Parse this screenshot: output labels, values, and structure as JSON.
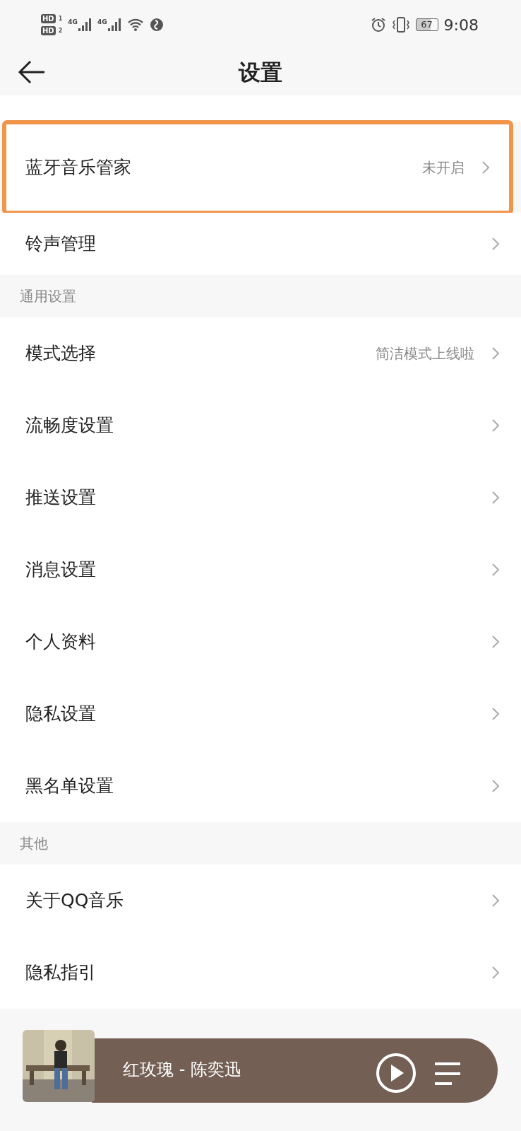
{
  "status_bar": {
    "hd_badges": [
      {
        "label": "HD",
        "slot": "1"
      },
      {
        "label": "HD",
        "slot": "2"
      }
    ],
    "networks": [
      "4G",
      "4G"
    ],
    "battery": "67",
    "time": "9:08"
  },
  "header": {
    "title": "设置"
  },
  "sections": [
    {
      "items": [
        {
          "label": "蓝牙音乐管家",
          "value": "未开启",
          "highlighted": true
        },
        {
          "label": "铃声管理",
          "highlighted": false
        }
      ]
    },
    {
      "title": "通用设置",
      "items": [
        {
          "label": "模式选择",
          "value": "简洁模式上线啦",
          "highlighted": false
        },
        {
          "label": "流畅度设置",
          "highlighted": false
        },
        {
          "label": "推送设置",
          "highlighted": false
        },
        {
          "label": "消息设置",
          "highlighted": false
        },
        {
          "label": "个人资料",
          "highlighted": false
        },
        {
          "label": "隐私设置",
          "highlighted": false
        },
        {
          "label": "黑名单设置",
          "highlighted": false
        }
      ]
    },
    {
      "title": "其他",
      "items": [
        {
          "label": "关于QQ音乐",
          "highlighted": false
        },
        {
          "label": "隐私指引",
          "highlighted": false
        }
      ]
    }
  ],
  "player": {
    "song": "红玫瑰 - 陈奕迅"
  }
}
